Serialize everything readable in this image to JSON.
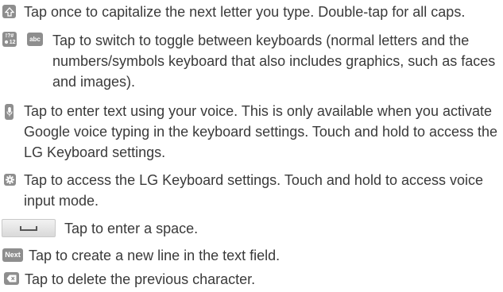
{
  "icons": {
    "shift": "shift-arrow-icon",
    "symbols_top": "!?#",
    "symbols_bottom": "☻12",
    "abc": "abc",
    "mic": "microphone-icon",
    "settings": "gear-icon",
    "space": "space-bar-icon",
    "next": "Next",
    "delete": "backspace-icon"
  },
  "items": [
    {
      "text": "Tap once to capitalize the next letter you type. Double-tap for all caps."
    },
    {
      "text": "Tap to switch to toggle between keyboards (normal letters and the numbers/symbols keyboard that also includes graphics, such as faces and images)."
    },
    {
      "text": "Tap to enter text using your voice. This is only available when you activate Google voice typing in the keyboard settings. Touch and hold to access the LG Keyboard settings."
    },
    {
      "text": "Tap to access the LG Keyboard settings. Touch and hold to access voice input mode."
    },
    {
      "text": "Tap to enter a space."
    },
    {
      "text": "Tap to create a new line in the text field."
    },
    {
      "text": "Tap to delete the previous character."
    }
  ],
  "colors": {
    "text": "#3a3a3a",
    "key": "#8e8e8e"
  }
}
